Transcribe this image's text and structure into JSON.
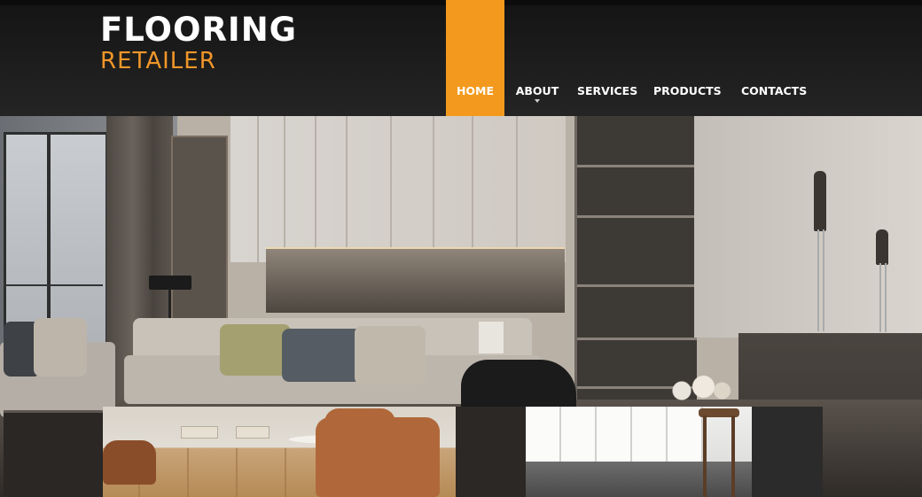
{
  "brand": {
    "name_line1": "FLOORING",
    "name_line2": "RETAILER",
    "accent_color": "#f39a1e"
  },
  "nav": {
    "items": [
      {
        "label": "HOME",
        "active": true
      },
      {
        "label": "ABOUT",
        "has_dropdown": true
      },
      {
        "label": "SERVICES"
      },
      {
        "label": "PRODUCTS"
      },
      {
        "label": "CONTACTS"
      }
    ]
  },
  "hero": {
    "image": "living-room-interior-photo"
  },
  "thumbnails": [
    {
      "image": "wooden-floor-lounge-photo"
    },
    {
      "image": "gray-floor-hallway-photo"
    }
  ]
}
